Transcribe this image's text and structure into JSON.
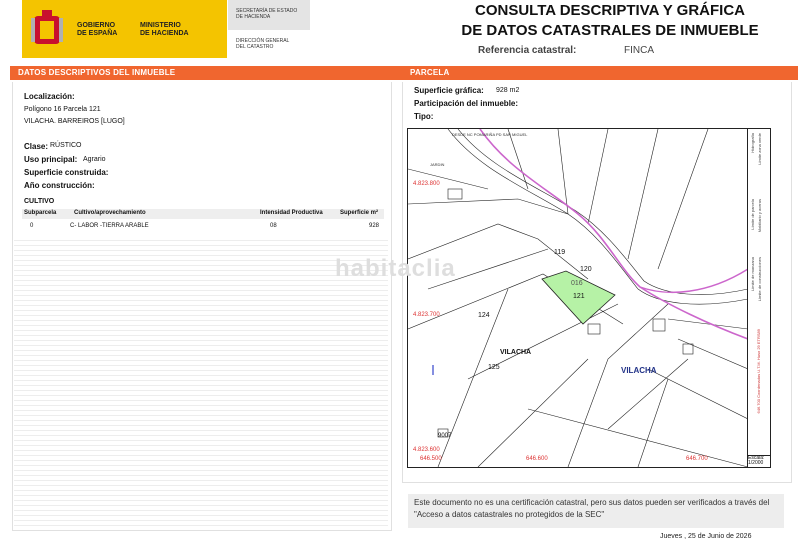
{
  "header": {
    "gov_line1": "GOBIERNO",
    "gov_line2": "DE ESPAÑA",
    "ministry_line1": "MINISTERIO",
    "ministry_line2": "DE HACIENDA",
    "sec_line1": "SECRETARÍA DE ESTADO",
    "sec_line2": "DE HACIENDA",
    "dg_line1": "DIRECCIÓN GENERAL",
    "dg_line2": "DEL CATASTRO",
    "title_line1": "CONSULTA DESCRIPTIVA Y GRÁFICA",
    "title_line2": "DE DATOS CATASTRALES DE INMUEBLE",
    "ref_label": "Referencia catastral:",
    "ref_value": "FINCA"
  },
  "left": {
    "section_title": "DATOS DESCRIPTIVOS DEL INMUEBLE",
    "localizacion_label": "Localización:",
    "localizacion_line1": "Polígono 16 Parcela 121",
    "localizacion_line2": "VILACHA. BARREIROS [LUGO]",
    "clase_label": "Clase:",
    "clase_value": "RÚSTICO",
    "uso_label": "Uso principal:",
    "uso_value": "Agrario",
    "superficie_label": "Superficie construida:",
    "anio_label": "Año construcción:",
    "cultivo_title": "CULTIVO",
    "cultivo_headers": [
      "Subparcela",
      "Cultivo/aprovechamiento",
      "Intensidad Productiva",
      "Superficie m²"
    ],
    "cultivo_rows": [
      [
        "0",
        "C- LABOR -TIERRA ARABLE",
        "08",
        "928"
      ]
    ]
  },
  "right": {
    "section_title": "PARCELA",
    "sup_grafica_label": "Superficie gráfica:",
    "sup_grafica_value": "928 m2",
    "participacion_label": "Participación del inmueble:",
    "tipo_label": "Tipo:"
  },
  "map": {
    "road_label": "DESDE NC POMARIÑA PD SAN MIGUEL",
    "jardin_label": "JARDIN",
    "coord_y1": "4.823.800",
    "coord_y2": "4.823.700",
    "coord_y3": "4.823.600",
    "coord_x1": "646.500",
    "coord_x2": "646.600",
    "coord_x3": "646.700",
    "parcel_119": "119",
    "parcel_120": "120",
    "parcel_121": "121",
    "parcel_016": "016",
    "parcel_124": "124",
    "parcel_125": "125",
    "parcel_9007": "9007",
    "village_left": "VILACHA",
    "village_right": "VILACHA",
    "legend_items": [
      "Límite de manzana",
      "Límite de parcela",
      "Límite de construcciones",
      "Mobiliario y aceras",
      "Límite zona verde",
      "Hidrografía"
    ],
    "legend_coords": "646.700 Coordenadas U.T.M. Huso 29 ETRS89",
    "scale_label": "Escala:",
    "scale_value": "1/2000",
    "highlight_color": "#b6f2a6",
    "road_color": "#cc66cc",
    "watermark": "habitaclia"
  },
  "footer": {
    "note": "Este documento no es una certificación catastral, pero sus datos pueden ser verificados a través del \"Acceso a datos catastrales no protegidos de la SEC\"",
    "date": "Jueves , 25 de Junio de 2026"
  }
}
